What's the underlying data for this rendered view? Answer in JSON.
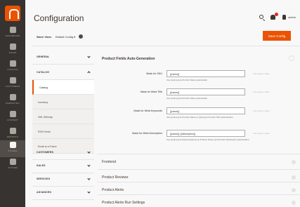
{
  "admin_menu": {
    "items": [
      {
        "label": "Dashboard",
        "icon": "dashboard-icon"
      },
      {
        "label": "Sales",
        "icon": "dollar-icon"
      },
      {
        "label": "Catalog",
        "icon": "cube-icon"
      },
      {
        "label": "Customers",
        "icon": "user-icon"
      },
      {
        "label": "Marketing",
        "icon": "megaphone-icon"
      },
      {
        "label": "Content",
        "icon": "layout-icon"
      },
      {
        "label": "Reports",
        "icon": "bar-chart-icon"
      },
      {
        "label": "Stores",
        "icon": "store-icon"
      },
      {
        "label": "System",
        "icon": "gear-icon"
      }
    ]
  },
  "header": {
    "title": "Configuration",
    "user_name": "admin"
  },
  "store_view": {
    "label": "Store View:",
    "value": "Default Config",
    "save_label": "Save Config"
  },
  "tabs": {
    "general": "GENERAL",
    "catalog": "CATALOG",
    "catalog_items": [
      "Catalog",
      "Inventory",
      "XML Sitemap",
      "RSS Feeds",
      "Email to a Friend"
    ],
    "customers": "CUSTOMERS",
    "sales": "SALES",
    "services": "SERVICES",
    "advanced": "ADVANCED"
  },
  "section": {
    "title": "Product Fields Auto-Generation",
    "use_default": "Use system value",
    "fields": [
      {
        "label": "Mask for SKU",
        "value": "{{name}}",
        "note": "Use {{name}} as Product Name placeholder"
      },
      {
        "label": "Mask for Meta Title",
        "value": "{{name}}",
        "note": "Use {{name}} as Product Name placeholder"
      },
      {
        "label": "Mask for Meta Keywords",
        "value": "{{name}}",
        "note": "Use {{name}} as Product Name or {{sku}} as Product SKU placeholders"
      },
      {
        "label": "Mask for Meta Description",
        "value": "{{name}} {{description}}",
        "note": "Use {{name}} and {{description}} as Product Name and Product Description placeholders"
      }
    ]
  },
  "groups": [
    "Frontend",
    "Product Reviews",
    "Product Alerts",
    "Product Alerts Run Settings"
  ],
  "colors": {
    "accent": "#eb5202",
    "menu_bg": "#373330"
  }
}
